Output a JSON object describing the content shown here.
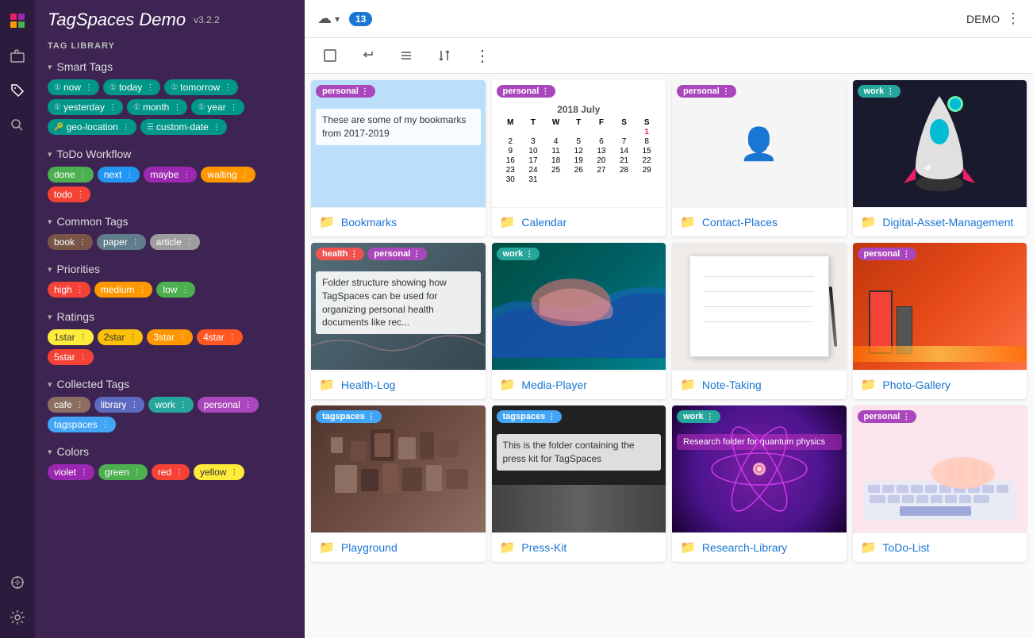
{
  "app": {
    "title": "TagSpaces Demo",
    "version": "v3.2.2",
    "demo_label": "DEMO",
    "count": "13"
  },
  "sidebar": {
    "tag_library_label": "TAG LIBRARY",
    "sections": [
      {
        "id": "smart-tags",
        "title": "Smart Tags",
        "tags": [
          {
            "label": "now",
            "prefix": "1",
            "class": "tag-smart"
          },
          {
            "label": "today",
            "prefix": "1",
            "class": "tag-smart"
          },
          {
            "label": "tomorrow",
            "prefix": "1",
            "class": "tag-smart"
          },
          {
            "label": "yesterday",
            "prefix": "1",
            "class": "tag-smart"
          },
          {
            "label": "month",
            "prefix": "1",
            "class": "tag-smart"
          },
          {
            "label": "year",
            "prefix": "1",
            "class": "tag-smart"
          },
          {
            "label": "geo-location",
            "prefix": "🔑",
            "class": "tag-smart"
          },
          {
            "label": "custom-date",
            "prefix": "☰",
            "class": "tag-smart"
          }
        ]
      },
      {
        "id": "todo-workflow",
        "title": "ToDo Workflow",
        "tags": [
          {
            "label": "done",
            "class": "tag-done"
          },
          {
            "label": "next",
            "class": "tag-next"
          },
          {
            "label": "maybe",
            "class": "tag-maybe"
          },
          {
            "label": "waiting",
            "class": "tag-waiting"
          },
          {
            "label": "todo",
            "class": "tag-todo"
          }
        ]
      },
      {
        "id": "common-tags",
        "title": "Common Tags",
        "tags": [
          {
            "label": "book",
            "class": "tag-book"
          },
          {
            "label": "paper",
            "class": "tag-paper"
          },
          {
            "label": "article",
            "class": "tag-article"
          }
        ]
      },
      {
        "id": "priorities",
        "title": "Priorities",
        "tags": [
          {
            "label": "high",
            "class": "tag-high"
          },
          {
            "label": "medium",
            "class": "tag-medium"
          },
          {
            "label": "low",
            "class": "tag-low"
          }
        ]
      },
      {
        "id": "ratings",
        "title": "Ratings",
        "tags": [
          {
            "label": "1star",
            "class": "tag-1star"
          },
          {
            "label": "2star",
            "class": "tag-2star"
          },
          {
            "label": "3star",
            "class": "tag-3star"
          },
          {
            "label": "4star",
            "class": "tag-4star"
          },
          {
            "label": "5star",
            "class": "tag-5star"
          }
        ]
      },
      {
        "id": "collected-tags",
        "title": "Collected Tags",
        "tags": [
          {
            "label": "cafe",
            "class": "tag-cafe"
          },
          {
            "label": "library",
            "class": "tag-library"
          },
          {
            "label": "work",
            "class": "tag-work"
          },
          {
            "label": "personal",
            "class": "tag-personal"
          },
          {
            "label": "tagspaces",
            "class": "tag-tagspaces"
          }
        ]
      },
      {
        "id": "colors",
        "title": "Colors",
        "tags": [
          {
            "label": "violet",
            "class": "tag-violet"
          },
          {
            "label": "green",
            "class": "tag-green"
          },
          {
            "label": "red",
            "class": "tag-red"
          },
          {
            "label": "yellow",
            "class": "tag-yellow"
          }
        ]
      }
    ]
  },
  "toolbar": {
    "select_all": "☐",
    "enter": "↩",
    "list_view": "≡",
    "sort": "⇅",
    "more": "⋮"
  },
  "cards": [
    {
      "id": "bookmarks",
      "title": "Bookmarks",
      "tags": [
        {
          "label": "personal",
          "class": "card-tag-personal"
        }
      ],
      "description": "These are some of my bookmarks from 2017-2019",
      "bg": "bg-light-blue",
      "type": "text"
    },
    {
      "id": "calendar",
      "title": "Calendar",
      "tags": [
        {
          "label": "personal",
          "class": "card-tag-personal"
        }
      ],
      "bg": "bg-calendar",
      "type": "calendar"
    },
    {
      "id": "contact-places",
      "title": "Contact-Places",
      "tags": [
        {
          "label": "personal",
          "class": "card-tag-personal"
        }
      ],
      "bg": "bg-white",
      "type": "plain"
    },
    {
      "id": "digital-asset-management",
      "title": "Digital-Asset-Management",
      "tags": [
        {
          "label": "work",
          "class": "card-tag-work"
        }
      ],
      "bg": "bg-dark",
      "type": "rocket"
    },
    {
      "id": "health-log",
      "title": "Health-Log",
      "tags": [
        {
          "label": "health",
          "class": "card-tag-health"
        },
        {
          "label": "personal",
          "class": "card-tag-personal"
        }
      ],
      "description": "Folder structure showing how TagSpaces can be used for organizing personal health documents like rec...",
      "bg": "bg-health",
      "type": "health-desc"
    },
    {
      "id": "media-player",
      "title": "Media-Player",
      "tags": [
        {
          "label": "work",
          "class": "card-tag-work"
        }
      ],
      "bg": "bg-aerial",
      "type": "aerial"
    },
    {
      "id": "note-taking",
      "title": "Note-Taking",
      "tags": [],
      "bg": "bg-notebook",
      "type": "notebook"
    },
    {
      "id": "photo-gallery",
      "title": "Photo-Gallery",
      "tags": [
        {
          "label": "personal",
          "class": "card-tag-personal"
        }
      ],
      "bg": "bg-city",
      "type": "city"
    },
    {
      "id": "playground",
      "title": "Playground",
      "tags": [
        {
          "label": "tagspaces",
          "class": "card-tag-tagspaces"
        }
      ],
      "bg": "bg-typography",
      "type": "typography"
    },
    {
      "id": "press-kit",
      "title": "Press-Kit",
      "tags": [
        {
          "label": "tagspaces",
          "class": "card-tag-tagspaces"
        }
      ],
      "description": "This is the folder containing the press kit for TagSpaces",
      "bg": "bg-presskit",
      "type": "press-desc"
    },
    {
      "id": "research-library",
      "title": "Research-Library",
      "tags": [
        {
          "label": "work",
          "class": "card-tag-work"
        }
      ],
      "description": "Research folder for quantum physics",
      "bg": "bg-quantum",
      "type": "quantum"
    },
    {
      "id": "todo-list",
      "title": "ToDo-List",
      "tags": [
        {
          "label": "personal",
          "class": "card-tag-personal"
        }
      ],
      "bg": "bg-keyboard",
      "type": "keyboard"
    }
  ]
}
